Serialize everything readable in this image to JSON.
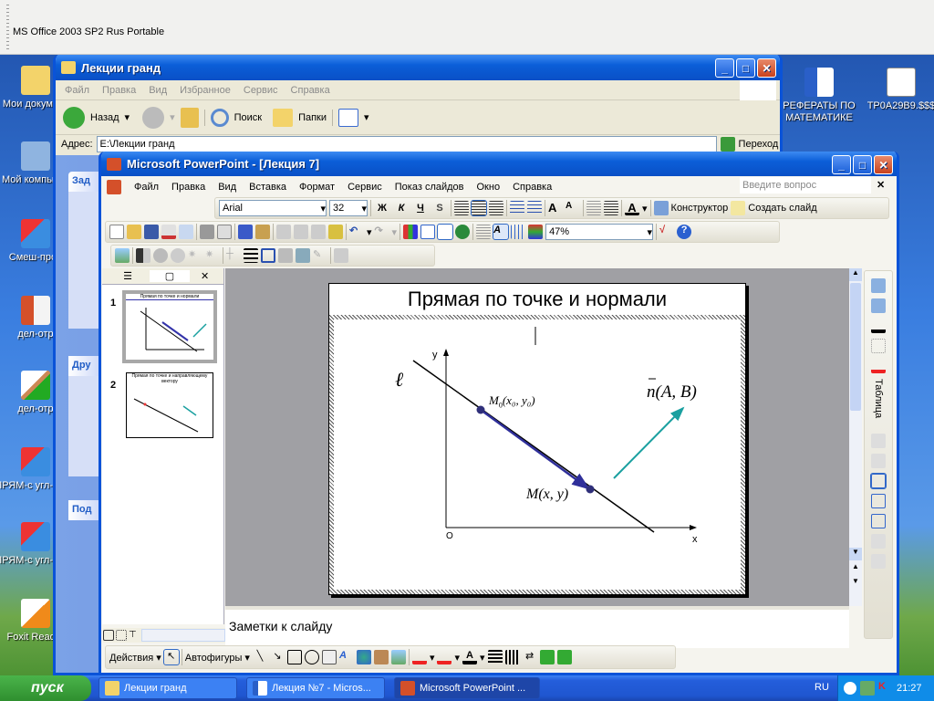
{
  "top_window": {
    "title": "MS Office 2003 SP2 Rus Portable"
  },
  "desktop_icons": [
    {
      "label": "Мои документ",
      "icon": "my-documents-icon"
    },
    {
      "label": "Мой компьюте",
      "icon": "my-computer-icon"
    },
    {
      "label": "Смеш-прои",
      "icon": "powerpoint-show-icon"
    },
    {
      "label": "дел-отр",
      "icon": "powerpoint-file-icon"
    },
    {
      "label": "дел-отр",
      "icon": "paint-file-icon"
    },
    {
      "label": "ПРЯМ-с угл-коэф",
      "icon": "powerpoint-show-icon"
    },
    {
      "label": "ПРЯМ-с угл-коэф",
      "icon": "powerpoint-show-icon"
    },
    {
      "label": "Foxit Reader",
      "icon": "foxit-reader-icon"
    },
    {
      "label": "РЕФЕРАТЫ ПО МАТЕМАТИКЕ",
      "icon": "word-doc-icon"
    },
    {
      "label": "TP0A29B9.$$$",
      "icon": "generic-file-icon"
    }
  ],
  "explorer": {
    "title": "Лекции гранд",
    "menu": [
      "Файл",
      "Правка",
      "Вид",
      "Избранное",
      "Сервис",
      "Справка"
    ],
    "back_label": "Назад",
    "search_label": "Поиск",
    "folders_label": "Папки",
    "address_label": "Адрес:",
    "address_value": "E:\\Лекции гранд",
    "go_label": "Переход",
    "panels": [
      "Зад",
      "Дру",
      "Под"
    ]
  },
  "ppt": {
    "title": "Microsoft PowerPoint - [Лекция 7]",
    "menu": [
      "Файл",
      "Правка",
      "Вид",
      "Вставка",
      "Формат",
      "Сервис",
      "Показ слайдов",
      "Окно",
      "Справка"
    ],
    "help_placeholder": "Введите вопрос",
    "font": "Arial",
    "font_size": "32",
    "bold": "Ж",
    "italic": "К",
    "underline": "Ч",
    "shadow": "S",
    "designer_label": "Конструктор",
    "new_slide_label": "Создать слайд",
    "zoom": "47%",
    "table_label": "Таблица",
    "notes_placeholder": "Заметки к слайду",
    "actions_label": "Действия",
    "autoshapes_label": "Автофигуры",
    "thumbnails": [
      {
        "num": "1",
        "title": "Прямая по точке и нормали"
      },
      {
        "num": "2",
        "title": "Прямая по точке и направляющему вектору"
      }
    ],
    "slide": {
      "title": "Прямая по точке и нормали",
      "line_label": "ℓ",
      "y_axis": "y",
      "x_axis": "x",
      "origin": "O",
      "m0_label": "M",
      "m0_sub": "0",
      "m0_args": "(x₀, y₀)",
      "m_label": "M(x, y)",
      "n_label": "n",
      "n_args": "(A, B)"
    }
  },
  "taskbar": {
    "start": "пуск",
    "items": [
      {
        "label": "Лекции гранд"
      },
      {
        "label": "Лекция №7 - Micros..."
      },
      {
        "label": "Microsoft PowerPoint ..."
      }
    ],
    "lang": "RU",
    "time": "21:27"
  },
  "colors": {
    "xp_blue": "#0a53d8",
    "segment": "#2f2f9a",
    "normal": "#1aa0a0"
  }
}
